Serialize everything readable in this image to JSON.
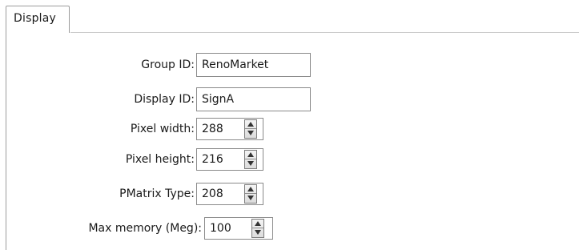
{
  "tabs": [
    {
      "label": "Display"
    }
  ],
  "form": {
    "group_id": {
      "label": "Group ID:",
      "value": "RenoMarket"
    },
    "display_id": {
      "label": "Display ID:",
      "value": "SignA"
    },
    "pixel_width": {
      "label": "Pixel width:",
      "value": "288"
    },
    "pixel_height": {
      "label": "Pixel height:",
      "value": "216"
    },
    "pmatrix_type": {
      "label": "PMatrix Type:",
      "value": "208"
    },
    "max_memory": {
      "label": "Max memory (Meg):",
      "value": "100"
    }
  },
  "icons": {
    "spin_up": "arrow-up-icon",
    "spin_down": "arrow-down-icon"
  }
}
